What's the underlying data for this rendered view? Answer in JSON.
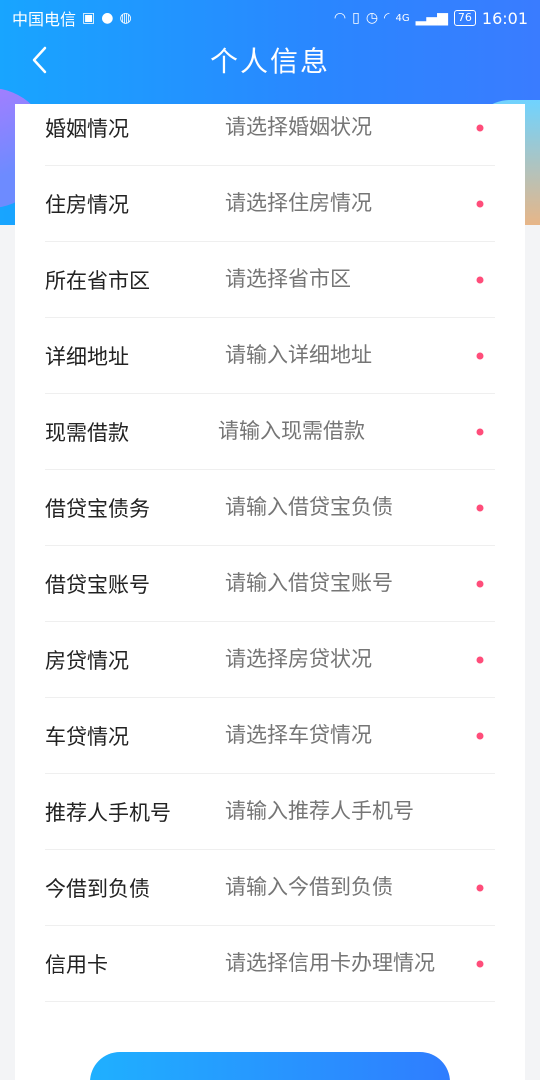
{
  "status_bar": {
    "carrier": "中国电信",
    "network": "4G",
    "battery": "76",
    "time": "16:01"
  },
  "header": {
    "title": "个人信息"
  },
  "form": {
    "rows": [
      {
        "label": "婚姻情况",
        "placeholder": "请选择婚姻状况",
        "required": true
      },
      {
        "label": "住房情况",
        "placeholder": "请选择住房情况",
        "required": true
      },
      {
        "label": "所在省市区",
        "placeholder": "请选择省市区",
        "required": true
      },
      {
        "label": "详细地址",
        "placeholder": "请输入详细地址",
        "required": true
      },
      {
        "label": "现需借款",
        "placeholder": "请输入现需借款",
        "required": true
      },
      {
        "label": "借贷宝债务",
        "placeholder": "请输入借贷宝负债",
        "required": true
      },
      {
        "label": "借贷宝账号",
        "placeholder": "请输入借贷宝账号",
        "required": true
      },
      {
        "label": "房贷情况",
        "placeholder": "请选择房贷状况",
        "required": true
      },
      {
        "label": "车贷情况",
        "placeholder": "请选择车贷情况",
        "required": true
      },
      {
        "label": "推荐人手机号",
        "placeholder": "请输入推荐人手机号",
        "required": false
      },
      {
        "label": "今借到负债",
        "placeholder": "请输入今借到负债",
        "required": true
      },
      {
        "label": "信用卡",
        "placeholder": "请选择信用卡办理情况",
        "required": true
      }
    ]
  },
  "colors": {
    "primary": "#2a86ff",
    "required_dot": "#ff4d7a"
  }
}
